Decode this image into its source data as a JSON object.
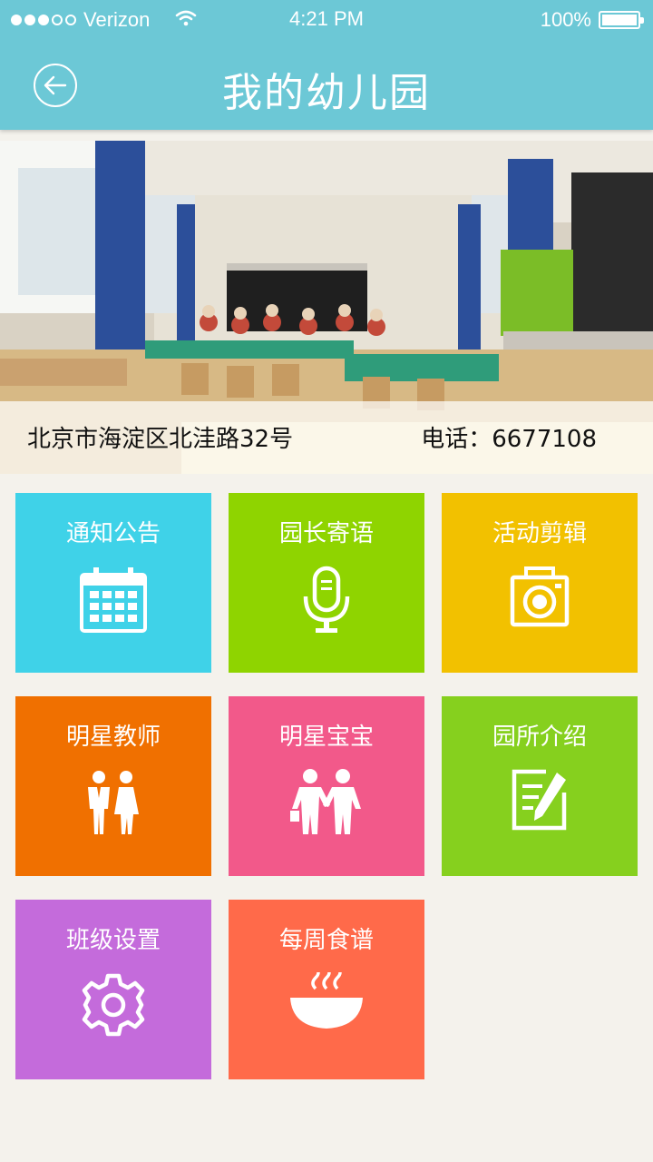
{
  "status_bar": {
    "carrier": "Verizon",
    "time": "4:21 PM",
    "battery": "100%",
    "signal_bars_filled": 3,
    "signal_bars_total": 5
  },
  "header": {
    "title": "我的幼儿园",
    "back_icon": "back-arrow-circle-icon"
  },
  "banner": {
    "address": "北京市海淀区北洼路32号",
    "phone": "电话：6677108"
  },
  "tiles": [
    {
      "label": "通知公告",
      "icon": "calendar-icon",
      "color": "#3fd2e8"
    },
    {
      "label": "园长寄语",
      "icon": "microphone-icon",
      "color": "#8fd400"
    },
    {
      "label": "活动剪辑",
      "icon": "camera-icon",
      "color": "#f2c100"
    },
    {
      "label": "明星教师",
      "icon": "teachers-icon",
      "color": "#f07000"
    },
    {
      "label": "明星宝宝",
      "icon": "kids-icon",
      "color": "#f2598a"
    },
    {
      "label": "园所介绍",
      "icon": "note-edit-icon",
      "color": "#86d01e"
    },
    {
      "label": "班级设置",
      "icon": "gear-icon",
      "color": "#c46bdb"
    },
    {
      "label": "每周食谱",
      "icon": "bowl-icon",
      "color": "#ff6a4a"
    }
  ],
  "colors": {
    "header_bg": "#6cc8d6",
    "page_bg": "#f4f2ec"
  }
}
